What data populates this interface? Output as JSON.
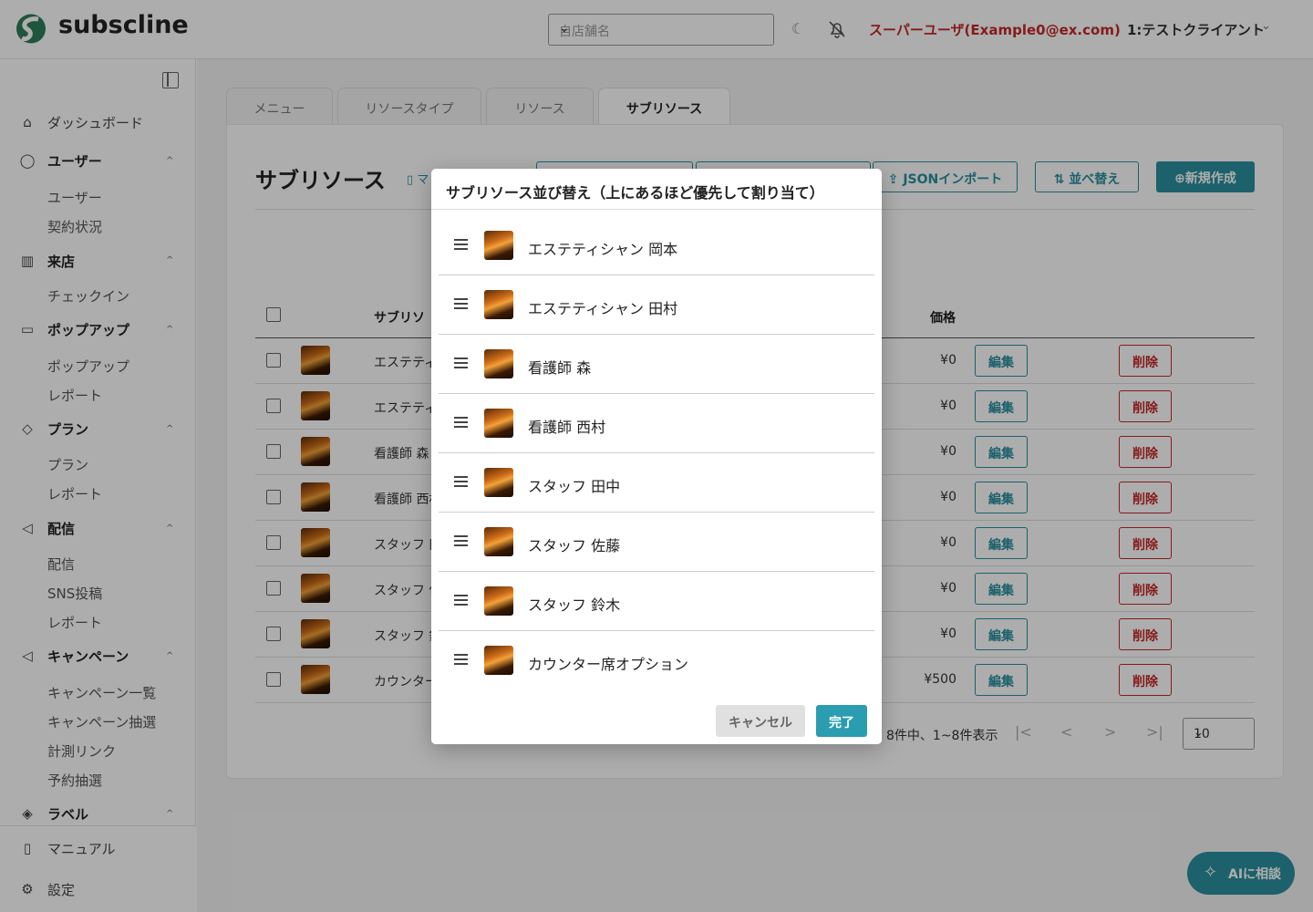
{
  "header": {
    "logo_text": "subscline",
    "store_placeholder": "自店舗名",
    "user_label": "スーパーユーザ(Example0@ex.com)",
    "client_label": "1:テストクライアント"
  },
  "sidebar": {
    "items": [
      {
        "label": "ダッシュボード",
        "icon": "home-icon"
      },
      {
        "label": "ユーザー",
        "icon": "user-icon",
        "children": [
          "ユーザー",
          "契約状況"
        ]
      },
      {
        "label": "来店",
        "icon": "building-icon",
        "children": [
          "チェックイン"
        ]
      },
      {
        "label": "ポップアップ",
        "icon": "window-icon",
        "children": [
          "ポップアップ",
          "レポート"
        ]
      },
      {
        "label": "プラン",
        "icon": "diamond-icon",
        "children": [
          "プラン",
          "レポート"
        ]
      },
      {
        "label": "配信",
        "icon": "megaphone-icon",
        "children": [
          "配信",
          "SNS投稿",
          "レポート"
        ]
      },
      {
        "label": "キャンペーン",
        "icon": "megaphone-icon",
        "children": [
          "キャンペーン一覧",
          "キャンペーン抽選",
          "計測リンク",
          "予約抽選"
        ]
      },
      {
        "label": "ラベル",
        "icon": "tag-icon"
      }
    ],
    "bottom": [
      {
        "label": "マニュアル",
        "icon": "book-icon"
      },
      {
        "label": "設定",
        "icon": "gear-icon"
      }
    ]
  },
  "tabs": [
    "メニュー",
    "リソースタイプ",
    "リソース",
    "サブリソース"
  ],
  "page": {
    "title": "サブリソース",
    "manual_link": "マ",
    "json_import": "JSONインポート",
    "sort_button": "並べ替え",
    "new_button": "新規作成"
  },
  "table": {
    "columns": {
      "name": "サブリソ",
      "price": "価格"
    },
    "edit_label": "編集",
    "delete_label": "削除",
    "rows": [
      {
        "name": "エステティ",
        "price": "¥0"
      },
      {
        "name": "エステティ",
        "price": "¥0"
      },
      {
        "name": "看護師 森",
        "price": "¥0"
      },
      {
        "name": "看護師 西村",
        "price": "¥0"
      },
      {
        "name": "スタッフ 田",
        "price": "¥0"
      },
      {
        "name": "スタッフ 佐",
        "price": "¥0"
      },
      {
        "name": "スタッフ 鈴",
        "price": "¥0"
      },
      {
        "name": "カウンター",
        "price": "¥500"
      }
    ],
    "pager_info": "8件中、1~8件表示",
    "per_page": "10"
  },
  "ai_button": "AIに相談",
  "modal": {
    "title": "サブリソース並び替え（上にあるほど優先して割り当て）",
    "items": [
      "エステティシャン 岡本",
      "エステティシャン 田村",
      "看護師 森",
      "看護師 西村",
      "スタッフ 田中",
      "スタッフ 佐藤",
      "スタッフ 鈴木",
      "カウンター席オプション"
    ],
    "cancel_label": "キャンセル",
    "done_label": "完了"
  },
  "colors": {
    "accent": "#2a8fa0",
    "danger": "#c62828"
  }
}
